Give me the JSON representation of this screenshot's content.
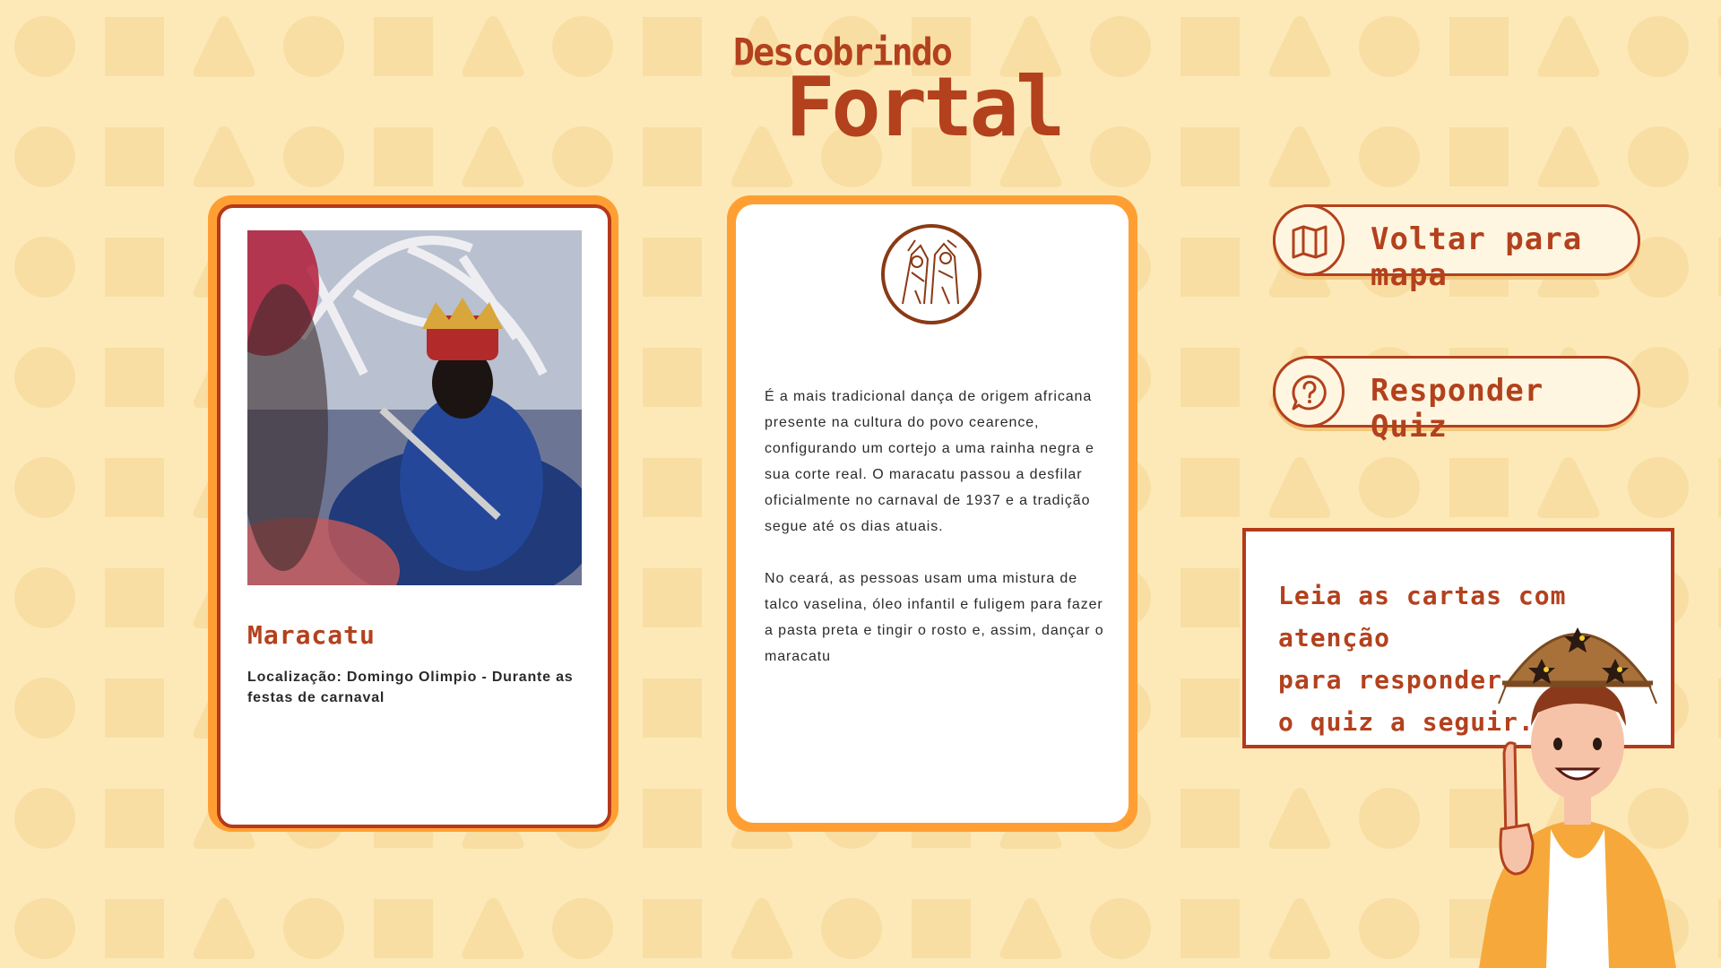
{
  "logo": {
    "line1": "Descobrindo",
    "line2": "Fortal"
  },
  "card_left": {
    "photo_alt": "Maracatu",
    "title": "Maracatu",
    "location": "Localização: Domingo Olimpio - Durante as festas de carnaval"
  },
  "card_mid": {
    "medallion_icon": "maracatu-figure-icon",
    "paragraph1": "É a mais tradicional dança de origem africana presente na cultura do povo cearence, configurando um cortejo a uma rainha negra e sua corte real. O maracatu passou a desfilar oficialmente no carnaval de 1937 e a tradição segue até os dias atuais.",
    "paragraph2": "No ceará, as pessoas usam uma mistura de talco vaselina, óleo infantil e fuligem para fazer a pasta preta e tingir o rosto e, assim, dançar o maracatu"
  },
  "buttons": {
    "map_label": "Voltar para mapa",
    "map_icon": "map-icon",
    "quiz_label": "Responder Quiz",
    "quiz_icon": "question-chat-icon"
  },
  "note": {
    "line1": "Leia as cartas com atenção",
    "line2": "para responder",
    "line3": "o quiz a seguir."
  },
  "colors": {
    "background": "#fde9b8",
    "accent": "#b3411d",
    "card_border": "#ff9f33"
  }
}
